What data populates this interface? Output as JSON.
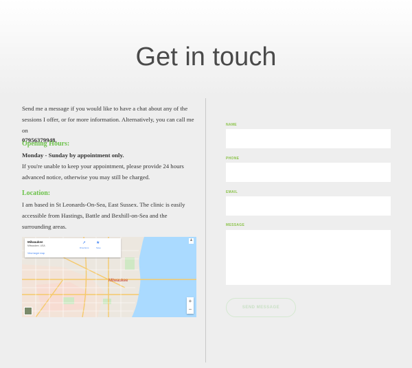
{
  "page": {
    "title": "Get in touch"
  },
  "info": {
    "intro": "Send me a message if you would like to have a chat about any of the sessions I offer, or for more information. Alternatively, you can call me on",
    "phone": "07956379948.",
    "hours_heading": "Opening Hours:",
    "hours_days": "Monday - Sunday by appointment only.",
    "hours_note": "If you're unable to keep your appointment, please provide 24 hours advanced notice, otherwise you may still be charged.",
    "location_heading": "Location:",
    "location_text": "I am based in St Leonards-On-Sea, East Sussex. The clinic is easily accessible from Hastings, Battle and Bexhill-on-Sea and the surrounding areas."
  },
  "map": {
    "place_name": "Milwaukee",
    "place_sub": "Milwaukee, USA",
    "larger_map_link": "View larger map",
    "directions_label": "Directions",
    "save_label": "Save",
    "city_label": "Milwaukee",
    "zoom_in": "+",
    "zoom_out": "−"
  },
  "form": {
    "name_label": "NAME",
    "phone_label": "PHONE",
    "email_label": "EMAIL",
    "message_label": "MESSAGE",
    "submit_label": "SEND MESSAGE"
  },
  "colors": {
    "accent_green": "#6cc24a",
    "label_green": "#8bc34a",
    "water": "#aadaff"
  }
}
